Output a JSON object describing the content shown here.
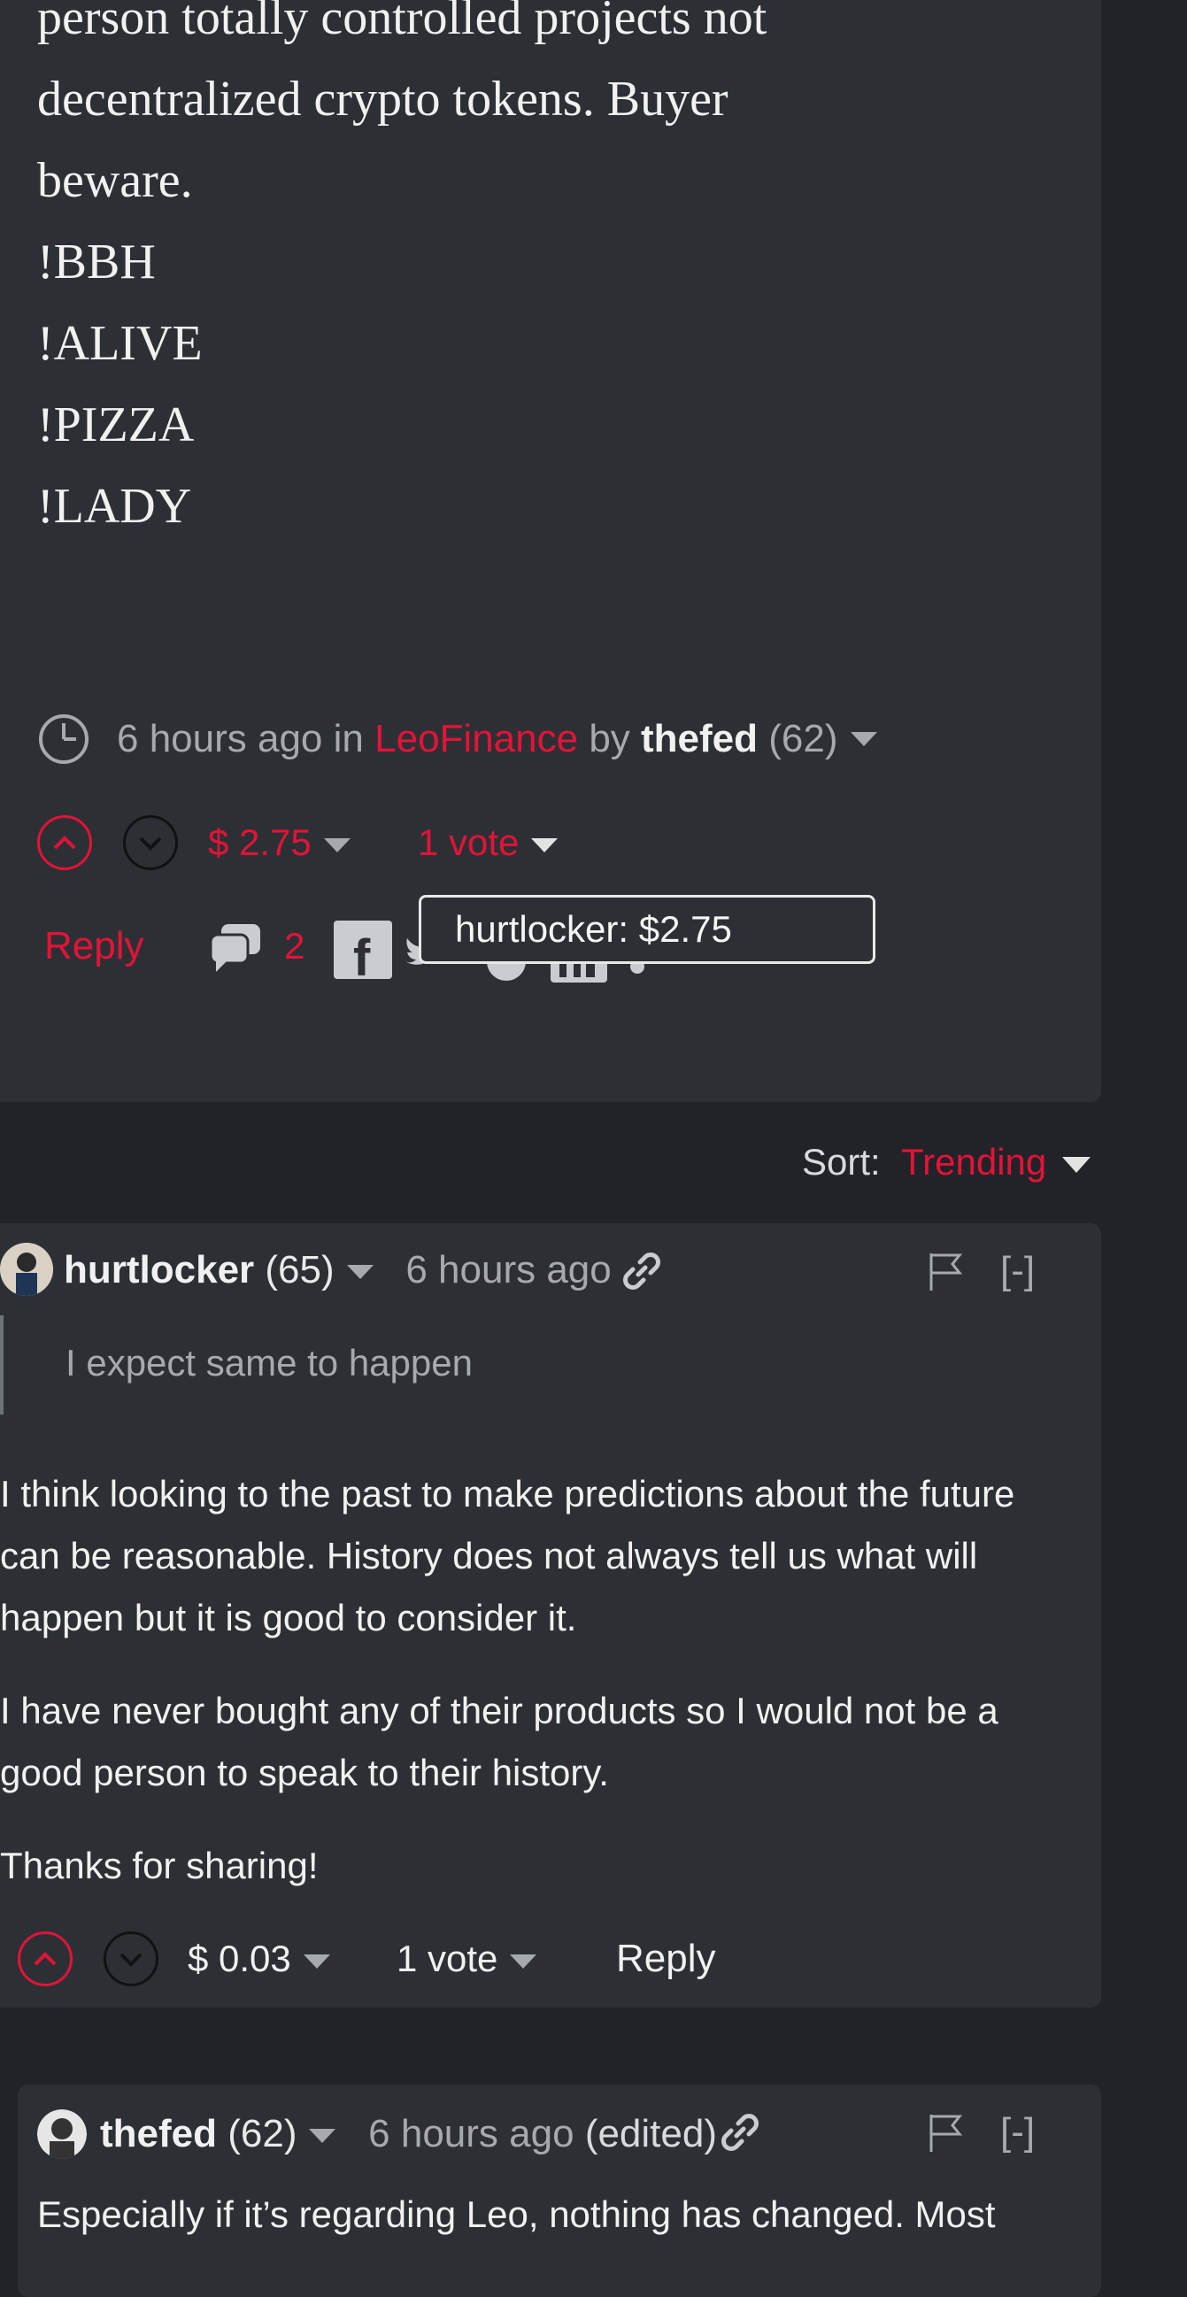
{
  "post": {
    "lines": [
      "person totally controlled projects not",
      "decentralized crypto tokens. Buyer",
      "beware.",
      "!BBH",
      "!ALIVE",
      "!PIZZA",
      "!LADY"
    ],
    "meta": {
      "time": "6 hours ago",
      "in_word": "in",
      "community": "LeoFinance",
      "by_word": "by",
      "author": "thefed",
      "reputation": "(62)"
    },
    "payout": "$ 2.75",
    "votes": "1 vote",
    "reply_label": "Reply",
    "comment_count": "2",
    "tooltip": "hurtlocker: $2.75"
  },
  "sort": {
    "label": "Sort:",
    "value": "Trending"
  },
  "comments": [
    {
      "author": "hurtlocker",
      "reputation": "(65)",
      "time": "6 hours ago",
      "collapse": "[-]",
      "quote": "I expect same to happen",
      "paragraphs": [
        [
          "I think looking to the past to make predictions about the future",
          "can be reasonable. History does not always tell us what will",
          "happen but it is good to consider it."
        ],
        [
          "I have never bought any of their products so I would not be a",
          "good person to speak to their history."
        ],
        [
          "Thanks for sharing!"
        ]
      ],
      "payout": "$ 0.03",
      "votes": "1 vote",
      "reply_label": "Reply"
    },
    {
      "author": "thefed",
      "reputation": "(62)",
      "time": "6 hours ago",
      "edited": "(edited)",
      "collapse": "[-]",
      "body_line": "Especially if it’s regarding Leo, nothing has changed. Most"
    }
  ],
  "colors": {
    "accent": "#e31337",
    "background": "#212328",
    "card": "#2c3035",
    "muted_text": "#a6a9ad"
  },
  "icons": [
    "clock-icon",
    "upvote-icon",
    "downvote-icon",
    "comments-icon",
    "facebook-icon",
    "twitter-icon",
    "reddit-icon",
    "linkedin-icon",
    "link-icon",
    "flag-icon",
    "chevron-down-icon"
  ]
}
